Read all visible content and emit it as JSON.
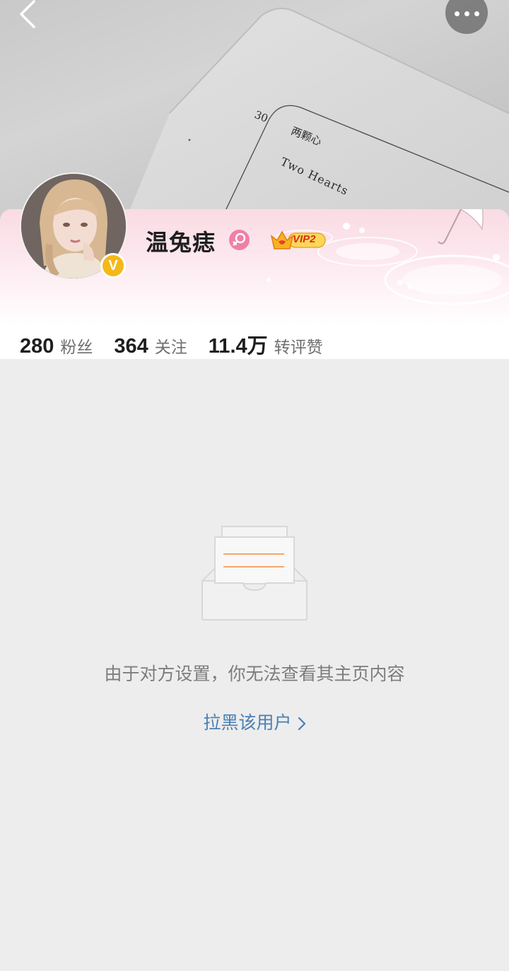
{
  "cover": {
    "page_number": "30",
    "chapter_title": "两颗心",
    "chapter_subtitle": "Two Hearts"
  },
  "nav": {
    "back_icon": "chevron-left-icon",
    "more_icon": "more-dots-icon"
  },
  "profile": {
    "username": "温兔痣",
    "gender_icon": "female-icon",
    "verified_badge": "V",
    "vip_label": "VIP2",
    "stats": [
      {
        "value": "280",
        "label": "粉丝"
      },
      {
        "value": "364",
        "label": "关注"
      },
      {
        "value": "11.4万",
        "label": "转评赞"
      }
    ]
  },
  "empty_state": {
    "icon": "empty-box-icon",
    "message": "由于对方设置，你无法查看其主页内容",
    "block_link": "拉黑该用户"
  },
  "colors": {
    "background": "#ededed",
    "link": "#4a7fb5",
    "verify_badge": "#f5b81a",
    "gender_pink": "#f07fa8",
    "card_pink": "#fadbe4"
  }
}
